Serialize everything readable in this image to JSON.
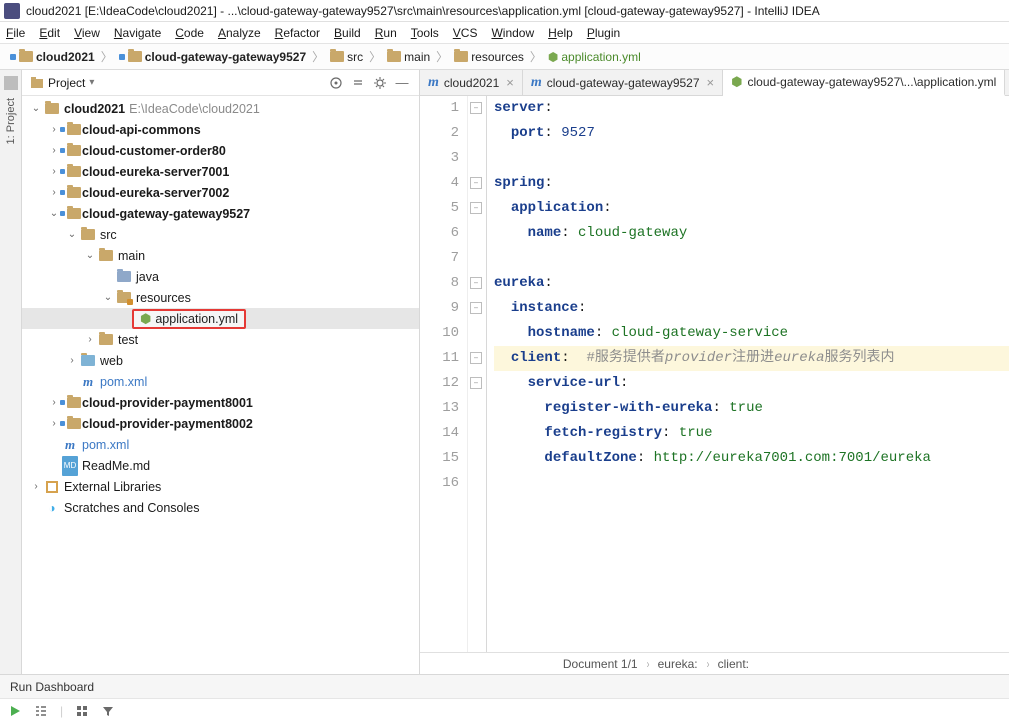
{
  "window": {
    "title": "cloud2021 [E:\\IdeaCode\\cloud2021] - ...\\cloud-gateway-gateway9527\\src\\main\\resources\\application.yml [cloud-gateway-gateway9527] - IntelliJ IDEA"
  },
  "menu": [
    "File",
    "Edit",
    "View",
    "Navigate",
    "Code",
    "Analyze",
    "Refactor",
    "Build",
    "Run",
    "Tools",
    "VCS",
    "Window",
    "Help",
    "Plugin"
  ],
  "breadcrumbs": [
    {
      "icon": "project",
      "label": "cloud2021",
      "bold": true
    },
    {
      "icon": "module",
      "label": "cloud-gateway-gateway9527",
      "bold": true
    },
    {
      "icon": "folder",
      "label": "src",
      "bold": false
    },
    {
      "icon": "folder",
      "label": "main",
      "bold": false
    },
    {
      "icon": "resource",
      "label": "resources",
      "bold": false
    },
    {
      "icon": "yml",
      "label": "application.yml",
      "bold": false,
      "yml": true
    }
  ],
  "sidebar_label": "1: Project",
  "projectPanel": {
    "title": "Project",
    "tree": [
      {
        "depth": 0,
        "arrow": "down",
        "icon": "project",
        "label": "cloud2021",
        "suffix": "E:\\IdeaCode\\cloud2021",
        "bold": true
      },
      {
        "depth": 1,
        "arrow": "right",
        "icon": "module",
        "label": "cloud-api-commons",
        "bold": true
      },
      {
        "depth": 1,
        "arrow": "right",
        "icon": "module",
        "label": "cloud-customer-order80",
        "bold": true
      },
      {
        "depth": 1,
        "arrow": "right",
        "icon": "module",
        "label": "cloud-eureka-server7001",
        "bold": true
      },
      {
        "depth": 1,
        "arrow": "right",
        "icon": "module",
        "label": "cloud-eureka-server7002",
        "bold": true
      },
      {
        "depth": 1,
        "arrow": "down",
        "icon": "module",
        "label": "cloud-gateway-gateway9527",
        "bold": true
      },
      {
        "depth": 2,
        "arrow": "down",
        "icon": "folder",
        "label": "src"
      },
      {
        "depth": 3,
        "arrow": "down",
        "icon": "folder",
        "label": "main"
      },
      {
        "depth": 4,
        "arrow": "",
        "icon": "folder-blue",
        "label": "java"
      },
      {
        "depth": 4,
        "arrow": "down",
        "icon": "resource",
        "label": "resources"
      },
      {
        "depth": 5,
        "arrow": "",
        "icon": "yml",
        "label": "application.yml",
        "selected": true,
        "highlight": true
      },
      {
        "depth": 3,
        "arrow": "right",
        "icon": "folder",
        "label": "test"
      },
      {
        "depth": 2,
        "arrow": "right",
        "icon": "folder-web",
        "label": "web"
      },
      {
        "depth": 2,
        "arrow": "",
        "icon": "pom",
        "label": "pom.xml",
        "pomStyle": true
      },
      {
        "depth": 1,
        "arrow": "right",
        "icon": "module",
        "label": "cloud-provider-payment8001",
        "bold": true
      },
      {
        "depth": 1,
        "arrow": "right",
        "icon": "module",
        "label": "cloud-provider-payment8002",
        "bold": true
      },
      {
        "depth": 1,
        "arrow": "",
        "icon": "pom",
        "label": "pom.xml",
        "pomStyle": true
      },
      {
        "depth": 1,
        "arrow": "",
        "icon": "md",
        "label": "ReadMe.md"
      },
      {
        "depth": 0,
        "arrow": "right",
        "icon": "lib",
        "label": "External Libraries"
      },
      {
        "depth": 0,
        "arrow": "",
        "icon": "scratch",
        "label": "Scratches and Consoles"
      }
    ]
  },
  "tabs": [
    {
      "icon": "m",
      "label": "cloud2021",
      "active": false,
      "closable": true,
      "color": "#3b78c4"
    },
    {
      "icon": "m",
      "label": "cloud-gateway-gateway9527",
      "active": false,
      "closable": true,
      "color": "#3b78c4"
    },
    {
      "icon": "yml",
      "label": "cloud-gateway-gateway9527\\...\\application.yml",
      "active": true,
      "closable": false,
      "color": "#7aa84f"
    }
  ],
  "editor": {
    "lineCount": 16,
    "lines": [
      {
        "n": 1,
        "segments": [
          [
            "k",
            "server"
          ],
          [
            "p",
            ":"
          ]
        ]
      },
      {
        "n": 2,
        "indent": 1,
        "segments": [
          [
            "k",
            "port"
          ],
          [
            "p",
            ": "
          ],
          [
            "v",
            "9527"
          ]
        ]
      },
      {
        "n": 3,
        "segments": []
      },
      {
        "n": 4,
        "segments": [
          [
            "k",
            "spring"
          ],
          [
            "p",
            ":"
          ]
        ]
      },
      {
        "n": 5,
        "indent": 1,
        "segments": [
          [
            "k",
            "application"
          ],
          [
            "p",
            ":"
          ]
        ]
      },
      {
        "n": 6,
        "indent": 2,
        "segments": [
          [
            "k",
            "name"
          ],
          [
            "p",
            ": "
          ],
          [
            "s",
            "cloud-gateway"
          ]
        ]
      },
      {
        "n": 7,
        "segments": []
      },
      {
        "n": 8,
        "segments": [
          [
            "k",
            "eureka"
          ],
          [
            "p",
            ":"
          ]
        ]
      },
      {
        "n": 9,
        "indent": 1,
        "segments": [
          [
            "k",
            "instance"
          ],
          [
            "p",
            ":"
          ]
        ]
      },
      {
        "n": 10,
        "indent": 2,
        "segments": [
          [
            "k",
            "hostname"
          ],
          [
            "p",
            ": "
          ],
          [
            "s",
            "cloud-gateway-service"
          ]
        ]
      },
      {
        "n": 11,
        "indent": 1,
        "hl": true,
        "segments": [
          [
            "k",
            "client"
          ],
          [
            "p",
            ":  "
          ],
          [
            "c",
            "#服务提供者"
          ],
          [
            "ci",
            "provider"
          ],
          [
            "c",
            "注册进"
          ],
          [
            "ci",
            "eureka"
          ],
          [
            "c",
            "服务列表内"
          ]
        ]
      },
      {
        "n": 12,
        "indent": 2,
        "segments": [
          [
            "k",
            "service-url"
          ],
          [
            "p",
            ":"
          ]
        ]
      },
      {
        "n": 13,
        "indent": 3,
        "segments": [
          [
            "k",
            "register-with-eureka"
          ],
          [
            "p",
            ": "
          ],
          [
            "s",
            "true"
          ]
        ]
      },
      {
        "n": 14,
        "indent": 3,
        "segments": [
          [
            "k",
            "fetch-registry"
          ],
          [
            "p",
            ": "
          ],
          [
            "s",
            "true"
          ]
        ]
      },
      {
        "n": 15,
        "indent": 3,
        "segments": [
          [
            "k",
            "defaultZone"
          ],
          [
            "p",
            ": "
          ],
          [
            "s",
            "http://eureka7001.com:7001/eureka"
          ]
        ]
      },
      {
        "n": 16,
        "segments": []
      }
    ],
    "foldMarks": [
      1,
      4,
      5,
      8,
      9,
      11,
      12
    ],
    "indentGuides": [
      0
    ]
  },
  "statusbar": {
    "doc": "Document 1/1",
    "path": [
      "eureka:",
      "client:"
    ]
  },
  "runDashboard": "Run Dashboard"
}
